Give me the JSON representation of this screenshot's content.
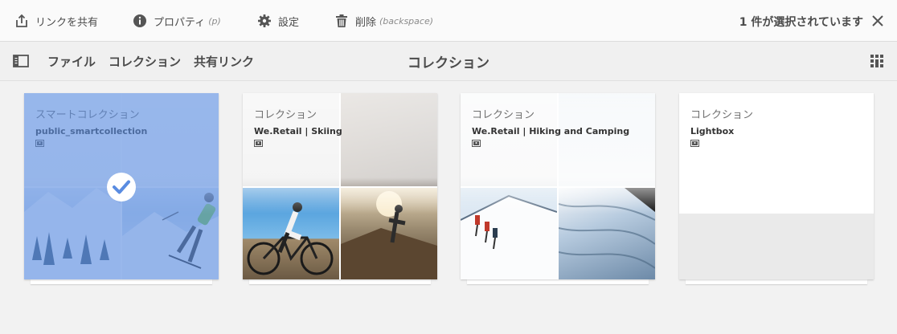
{
  "actionbar": {
    "share": {
      "label": "リンクを共有"
    },
    "properties": {
      "label": "プロパティ",
      "hint": "(p)"
    },
    "settings": {
      "label": "設定"
    },
    "delete": {
      "label": "削除",
      "hint": "(backspace)"
    },
    "selection_status": "1 件が選択されています",
    "icons": {
      "share": "share-icon",
      "properties": "info-icon",
      "settings": "gear-icon",
      "delete": "trash-icon",
      "close": "close-icon"
    }
  },
  "titlebar": {
    "nav": [
      {
        "label": "ファイル"
      },
      {
        "label": "コレクション"
      },
      {
        "label": "共有リンク"
      }
    ],
    "title": "コレクション",
    "icons": {
      "rail": "rail-toggle-icon",
      "view": "card-view-icon"
    }
  },
  "cards": [
    {
      "type": "スマートコレクション",
      "name": "public_smartcollection",
      "selected": true
    },
    {
      "type": "コレクション",
      "name": "We.Retail | Skiing",
      "selected": false
    },
    {
      "type": "コレクション",
      "name": "We.Retail | Hiking and Camping",
      "selected": false
    },
    {
      "type": "コレクション",
      "name": "Lightbox",
      "selected": false
    }
  ],
  "colors": {
    "selection": "#5a8ce1",
    "text": "#4b4b4b",
    "background": "#f2f2f2"
  }
}
